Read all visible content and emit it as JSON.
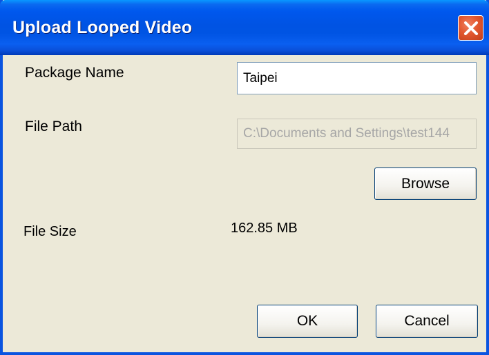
{
  "window": {
    "title": "Upload Looped Video"
  },
  "form": {
    "package_name_label": "Package Name",
    "package_name_value": "Taipei",
    "file_path_label": "File Path",
    "file_path_value": "C:\\Documents and Settings\\test144",
    "file_size_label": "File Size",
    "file_size_value": "162.85 MB"
  },
  "buttons": {
    "browse": "Browse",
    "ok": "OK",
    "cancel": "Cancel"
  },
  "colors": {
    "titlebar": "#0054e3",
    "dialog_bg": "#ece9d8",
    "close_button": "#e2572f"
  }
}
